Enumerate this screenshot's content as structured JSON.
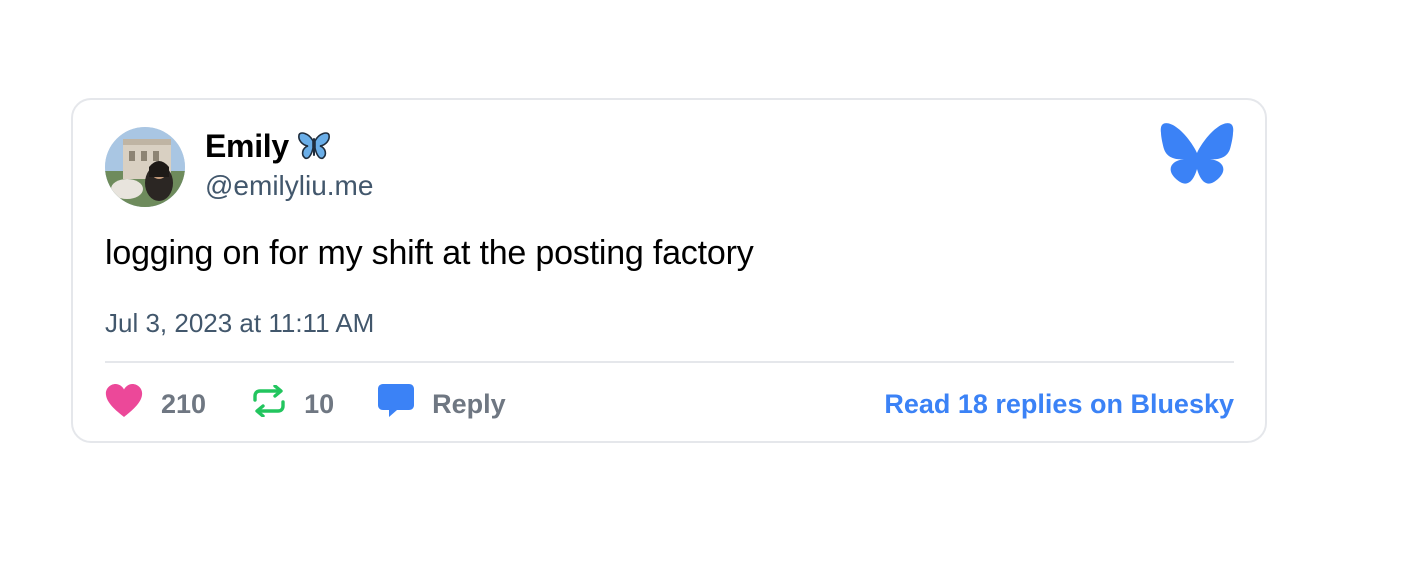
{
  "post": {
    "author_name": "Emily",
    "author_handle": "@emilyliu.me",
    "text": "logging on for my shift at the posting factory",
    "timestamp": "Jul 3, 2023 at 11:11 AM"
  },
  "actions": {
    "like_count": "210",
    "repost_count": "10",
    "reply_label": "Reply",
    "read_more_label": "Read 18 replies on Bluesky"
  },
  "icons": {
    "name_emoji": "butterfly-emoji-icon",
    "logo": "bluesky-butterfly-icon",
    "like": "heart-icon",
    "repost": "repost-icon",
    "reply": "speech-bubble-icon"
  },
  "colors": {
    "accent": "#3b82f6",
    "like": "#ec4899",
    "repost": "#22c55e",
    "muted_text": "#42576c",
    "action_text": "#6f7782",
    "border": "#e5e7eb"
  }
}
